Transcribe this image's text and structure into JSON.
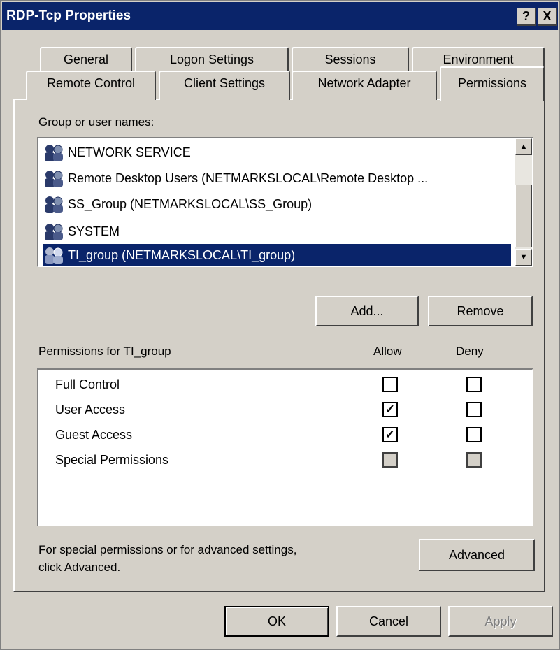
{
  "window": {
    "title": "RDP-Tcp Properties",
    "help_label": "?",
    "close_label": "X"
  },
  "tabs": {
    "row1": [
      "General",
      "Logon Settings",
      "Sessions",
      "Environment"
    ],
    "row2": [
      "Remote Control",
      "Client Settings",
      "Network Adapter",
      "Permissions"
    ],
    "active": "Permissions"
  },
  "group_list": {
    "label": "Group or user names:",
    "items": [
      {
        "name": "NETWORK SERVICE",
        "icon": "user-group-icon"
      },
      {
        "name": "Remote Desktop Users (NETMARKSLOCAL\\Remote Desktop ...",
        "icon": "user-group-icon"
      },
      {
        "name": "SS_Group (NETMARKSLOCAL\\SS_Group)",
        "icon": "user-group-icon"
      },
      {
        "name": "SYSTEM",
        "icon": "user-group-icon"
      },
      {
        "name": "TI_group (NETMARKSLOCAL\\TI_group)",
        "icon": "user-group-icon",
        "selected": true
      }
    ]
  },
  "buttons": {
    "add": "Add...",
    "remove": "Remove",
    "advanced": "Advanced",
    "ok": "OK",
    "cancel": "Cancel",
    "apply": "Apply"
  },
  "permissions": {
    "label": "Permissions for TI_group",
    "allow_header": "Allow",
    "deny_header": "Deny",
    "rows": [
      {
        "name": "Full Control",
        "allow": false,
        "deny": false,
        "grey": false
      },
      {
        "name": "User Access",
        "allow": true,
        "deny": false,
        "grey": false
      },
      {
        "name": "Guest Access",
        "allow": true,
        "deny": false,
        "grey": false
      },
      {
        "name": "Special Permissions",
        "allow": false,
        "deny": false,
        "grey": true
      }
    ]
  },
  "advanced_text": {
    "line1": "For special permissions or for advanced settings,",
    "line2": "click Advanced."
  },
  "colors": {
    "face": "#d4d0c8",
    "titlebar": "#0a246a",
    "selection": "#0a246a"
  }
}
